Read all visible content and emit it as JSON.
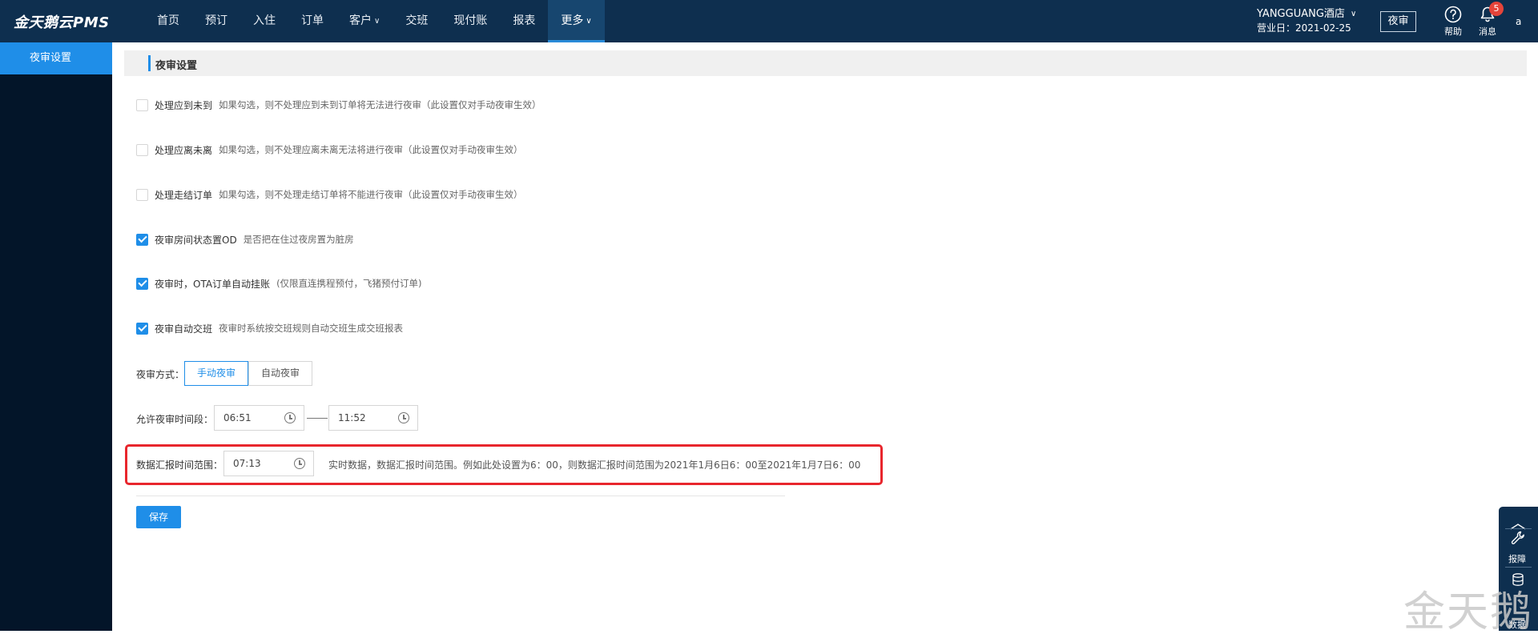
{
  "brand": "金天鹅云PMS",
  "nav": [
    {
      "label": "首页"
    },
    {
      "label": "预订"
    },
    {
      "label": "入住"
    },
    {
      "label": "订单"
    },
    {
      "label": "客户",
      "caret": "∨"
    },
    {
      "label": "交班"
    },
    {
      "label": "现付账"
    },
    {
      "label": "报表"
    },
    {
      "label": "更多",
      "caret": "∨"
    }
  ],
  "hotel": {
    "name": "YANGGUANG酒店",
    "caret": "∨",
    "date": "营业日：2021-02-25"
  },
  "night_audit_button": "夜审",
  "help": {
    "icon": "question-circle-icon",
    "glyph": "?",
    "label": "帮助"
  },
  "messages": {
    "icon": "bell-icon",
    "label": "消息",
    "count": "5"
  },
  "user": "a",
  "sidebar": {
    "items": [
      {
        "label": "夜审设置"
      }
    ]
  },
  "section_title": "夜审设置",
  "options": [
    {
      "label": "处理应到未到",
      "desc": "如果勾选，则不处理应到未到订单将无法进行夜审（此设置仅对手动夜审生效）",
      "checked": false
    },
    {
      "label": "处理应离未离",
      "desc": "如果勾选，则不处理应离未离无法将进行夜审（此设置仅对手动夜审生效）",
      "checked": false
    },
    {
      "label": "处理走结订单",
      "desc": "如果勾选，则不处理走结订单将不能进行夜审（此设置仅对手动夜审生效）",
      "checked": false
    },
    {
      "label": "夜审房间状态置OD",
      "desc": "是否把在住过夜房置为脏房",
      "checked": true
    },
    {
      "label": "夜审时，OTA订单自动挂账",
      "desc": "(仅限直连携程预付，飞猪预付订单)",
      "checked": true
    },
    {
      "label": "夜审自动交班",
      "desc": "夜审时系统按交班规则自动交班生成交班报表",
      "checked": true
    }
  ],
  "audit_mode": {
    "label": "夜审方式：",
    "options": [
      "手动夜审",
      "自动夜审"
    ],
    "selected": "手动夜审"
  },
  "allowed_time": {
    "label": "允许夜审时间段：",
    "start": "06:51",
    "end": "11:52"
  },
  "report_range": {
    "label": "数据汇报时间范围：",
    "value": "07:13",
    "hint": "实时数据，数据汇报时间范围。例如此处设置为6：00，则数据汇报时间范围为2021年1月6日6：00至2021年1月7日6：00"
  },
  "save_button": "保存",
  "float_panel": {
    "report_label": "报障",
    "data_label": "数据"
  },
  "watermark": "金天鹅",
  "colors": {
    "topbar": "#0e2f4f",
    "sidebar": "#031529",
    "accent": "#1f8ee8",
    "highlight": "#e8262d"
  }
}
